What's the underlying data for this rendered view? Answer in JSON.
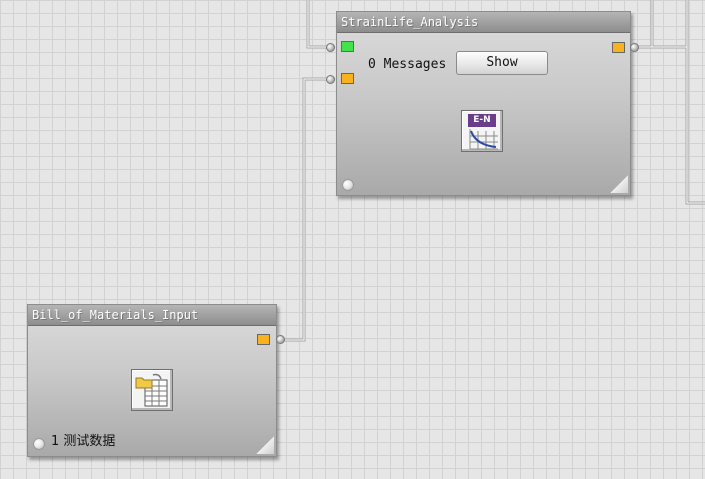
{
  "nodes": {
    "strainlife": {
      "title": "StrainLife_Analysis",
      "messages_label": "0 Messages",
      "show_button": "Show",
      "icon_badge": "E-N",
      "icon_name": "strain-life-en-icon"
    },
    "bom": {
      "title": "Bill_of_Materials_Input",
      "status_text": "1 测试数据",
      "icon_name": "table-folder-icon"
    }
  },
  "colors": {
    "port_green": "#41e24a",
    "port_yellow": "#f7b21e",
    "title_bar": "#8d8d8d",
    "canvas_bg": "#e6e6e6",
    "grid": "#d2d2d2",
    "en_badge": "#6a3c8c"
  }
}
